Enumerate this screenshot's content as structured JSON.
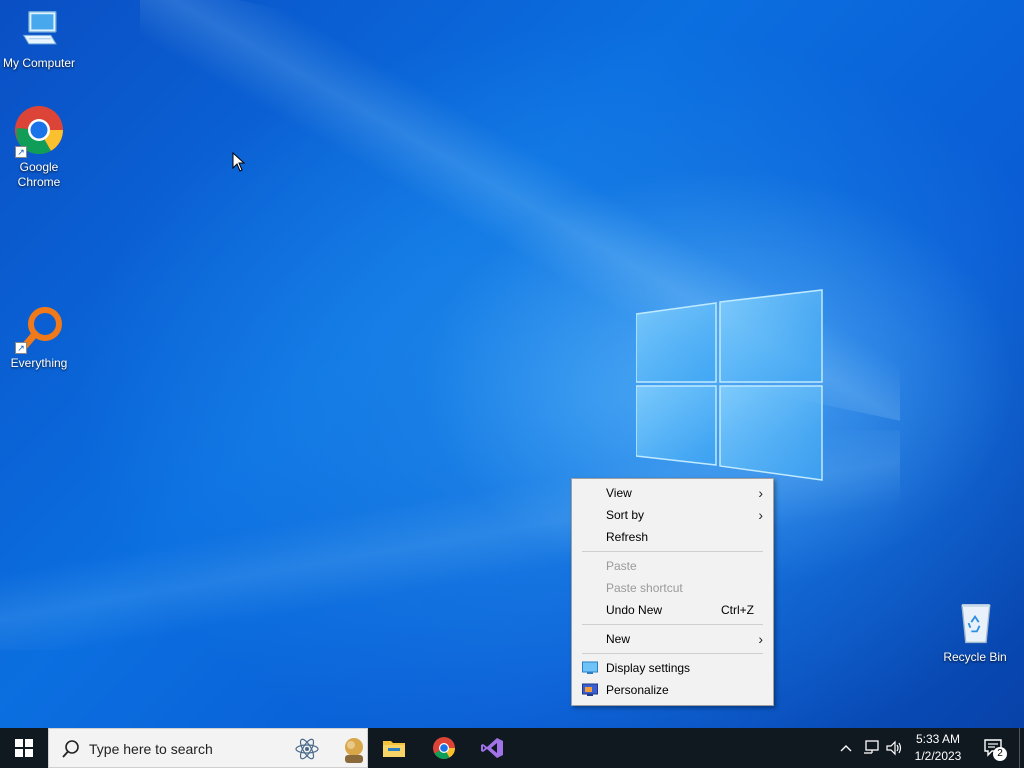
{
  "desktop": {
    "icons": [
      {
        "label": "My Computer"
      },
      {
        "label": "Google Chrome"
      },
      {
        "label": "Everything"
      },
      {
        "label": "Recycle Bin"
      }
    ]
  },
  "context_menu": {
    "items": {
      "view": {
        "label": "View"
      },
      "sort_by": {
        "label": "Sort by"
      },
      "refresh": {
        "label": "Refresh"
      },
      "paste": {
        "label": "Paste"
      },
      "paste_shortcut": {
        "label": "Paste shortcut"
      },
      "undo_new": {
        "label": "Undo New",
        "shortcut": "Ctrl+Z"
      },
      "new": {
        "label": "New"
      },
      "display_settings": {
        "label": "Display settings"
      },
      "personalize": {
        "label": "Personalize"
      }
    },
    "submenu_arrow": "›"
  },
  "taskbar": {
    "search_placeholder": "Type here to search",
    "pinned_apps": [
      "File Explorer",
      "Google Chrome",
      "Visual Studio"
    ],
    "clock": {
      "time": "5:33 AM",
      "date": "1/2/2023"
    },
    "notification_count": "2"
  },
  "colors": {
    "desktop_blue": "#0b6fe0",
    "taskbar": "#101820",
    "menu_bg": "#f2f2f2"
  }
}
